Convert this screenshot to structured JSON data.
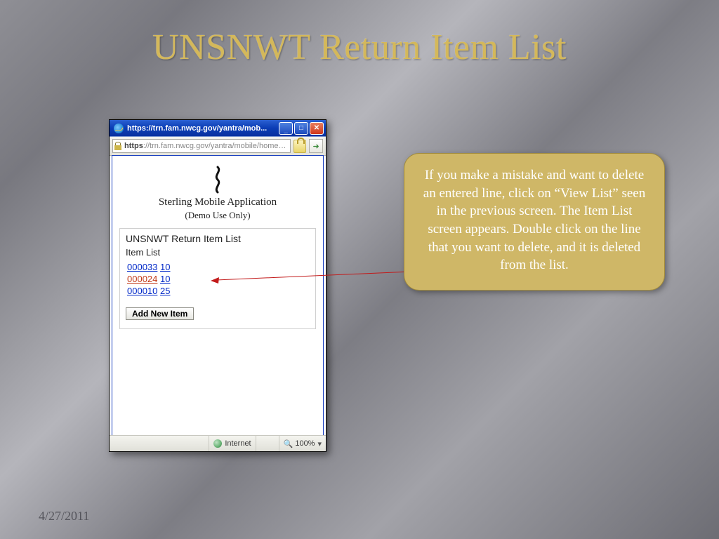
{
  "slide": {
    "title": "UNSNWT Return Item List",
    "date": "4/27/2011"
  },
  "browser": {
    "title_text": "https://trn.fam.nwcg.gov/yantra/mob...",
    "url_scheme": "https",
    "url_display": "://trn.fam.nwcg.gov/yantra/mobile/home.jsp",
    "url_domain": "nwcg.gov",
    "status_zone": "Internet",
    "zoom": "100%"
  },
  "app": {
    "title": "Sterling Mobile Application",
    "subtitle": "(Demo Use Only)"
  },
  "panel": {
    "heading": "UNSNWT Return Item List",
    "subheading": "Item List",
    "items": [
      {
        "code": "000033",
        "qty": "10",
        "selected": false
      },
      {
        "code": "000024",
        "qty": "10",
        "selected": true
      },
      {
        "code": "000010",
        "qty": "25",
        "selected": false
      }
    ],
    "add_button": "Add New Item"
  },
  "callout": {
    "text": "If you make a mistake and want to delete an entered line, click on “View List” seen in the previous screen. The Item List screen appears. Double click on the line that you want to delete, and it is deleted from the list."
  }
}
